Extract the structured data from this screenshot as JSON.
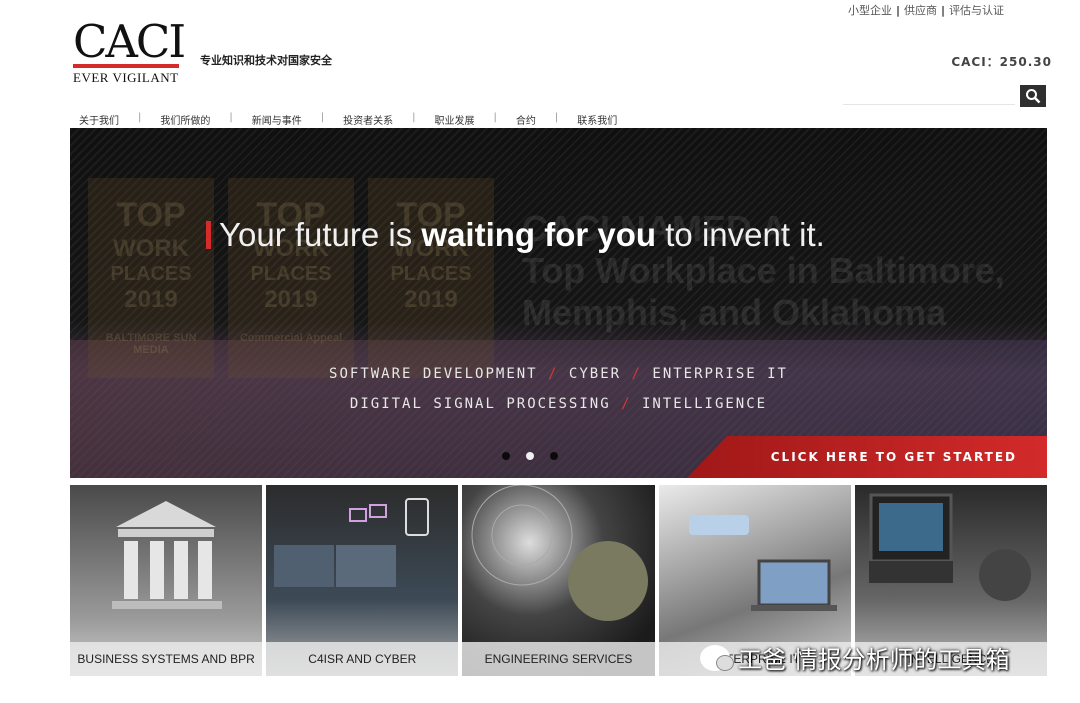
{
  "util_links": [
    "小型企业",
    "供应商",
    "评估与认证"
  ],
  "logo": {
    "word": "CACI",
    "tagline": "EVER VIGILANT",
    "accent_color": "#d42a2a"
  },
  "tagline": "专业知识和技术对国家安全",
  "stock": "CACI：250.30",
  "search": {
    "placeholder": "",
    "icon": "search-icon"
  },
  "nav": [
    "关于我们",
    "我们所做的",
    "新闻与事件",
    "投资者关系",
    "职业发展",
    "合约",
    "联系我们"
  ],
  "hero": {
    "background_text": [
      "CACI NAMED A",
      "Top Workplace in Baltimore,",
      "Memphis, and Oklahoma"
    ],
    "badges": [
      {
        "lines": [
          "TOP",
          "WORK",
          "PLACES",
          "2019"
        ],
        "source": "BALTIMORE SUN MEDIA"
      },
      {
        "lines": [
          "TOP",
          "WORK",
          "PLACES",
          "2019"
        ],
        "source": "Commercial Appeal"
      },
      {
        "lines": [
          "TOP",
          "WORK",
          "PLACES",
          "2019"
        ],
        "source": ""
      }
    ],
    "headline": {
      "pre": "Your future is",
      "bold": "waiting for you",
      "post": "to invent it."
    },
    "services_line1": [
      "SOFTWARE DEVELOPMENT",
      "CYBER",
      "ENTERPRISE IT"
    ],
    "services_line2": [
      "DIGITAL SIGNAL PROCESSING",
      "INTELLIGENCE"
    ],
    "slash": "/",
    "carousel": {
      "count": 3,
      "active": 2
    },
    "cta": "CLICK HERE TO GET STARTED"
  },
  "tiles": [
    "BUSINESS SYSTEMS AND BPR",
    "C4ISR AND CYBER",
    "ENGINEERING SERVICES",
    "ENTERPRISE IT",
    "INTELLIGENCE"
  ],
  "watermark": "工爸 情报分析师的工具箱"
}
